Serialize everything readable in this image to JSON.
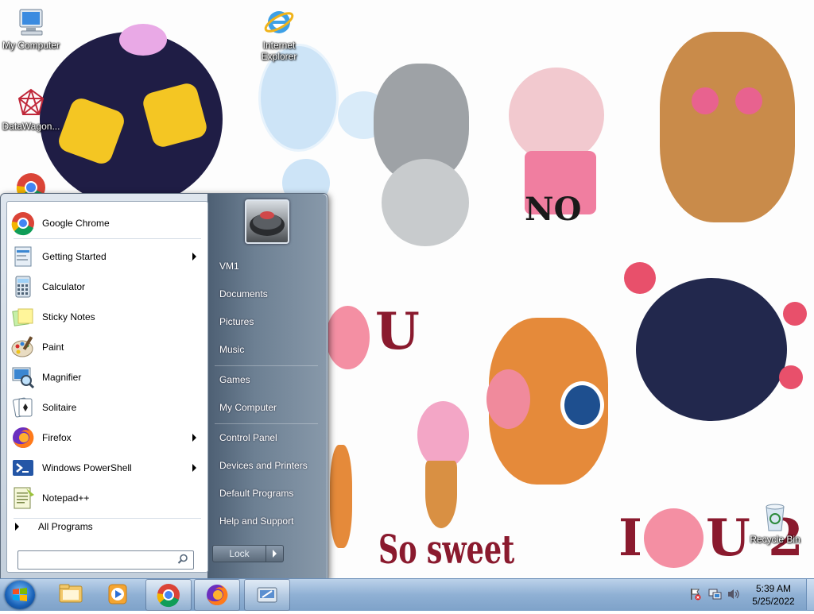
{
  "desktop": {
    "icons": [
      {
        "label": "My Computer",
        "icon": "computer-icon"
      },
      {
        "label": "Internet Explorer",
        "icon": "internet-explorer-icon"
      },
      {
        "label": "DataWagon...",
        "icon": "datawagon-icon"
      },
      {
        "label": "Recycle Bin",
        "icon": "recycle-bin-icon"
      }
    ],
    "wallpaper_text": [
      "NO",
      "U",
      "So sweet",
      "I",
      "U 2"
    ]
  },
  "start_menu": {
    "programs": [
      {
        "label": "Google Chrome",
        "icon": "chrome-icon",
        "submenu": false
      },
      {
        "label": "Getting Started",
        "icon": "getting-started-icon",
        "submenu": true
      },
      {
        "label": "Calculator",
        "icon": "calculator-icon",
        "submenu": false
      },
      {
        "label": "Sticky Notes",
        "icon": "sticky-notes-icon",
        "submenu": false
      },
      {
        "label": "Paint",
        "icon": "paint-icon",
        "submenu": false
      },
      {
        "label": "Magnifier",
        "icon": "magnifier-icon",
        "submenu": false
      },
      {
        "label": "Solitaire",
        "icon": "solitaire-icon",
        "submenu": false
      },
      {
        "label": "Firefox",
        "icon": "firefox-icon",
        "submenu": true
      },
      {
        "label": "Windows PowerShell",
        "icon": "powershell-icon",
        "submenu": true
      },
      {
        "label": "Notepad++",
        "icon": "notepadpp-icon",
        "submenu": false
      }
    ],
    "all_programs": "All Programs",
    "search_placeholder": "",
    "right_items": [
      "VM1",
      "Documents",
      "Pictures",
      "Music",
      "Games",
      "My Computer",
      "Control Panel",
      "Devices and Printers",
      "Default Programs",
      "Help and Support"
    ],
    "lock_label": "Lock"
  },
  "taskbar": {
    "buttons": [
      "explorer-icon",
      "media-player-icon",
      "chrome-icon",
      "firefox-icon",
      "remote-desktop-icon"
    ],
    "clock": {
      "time": "5:39 AM",
      "date": "5/25/2022"
    }
  },
  "colors": {
    "accent": "#4d5f73",
    "taskbar": "#8fb0d4"
  }
}
